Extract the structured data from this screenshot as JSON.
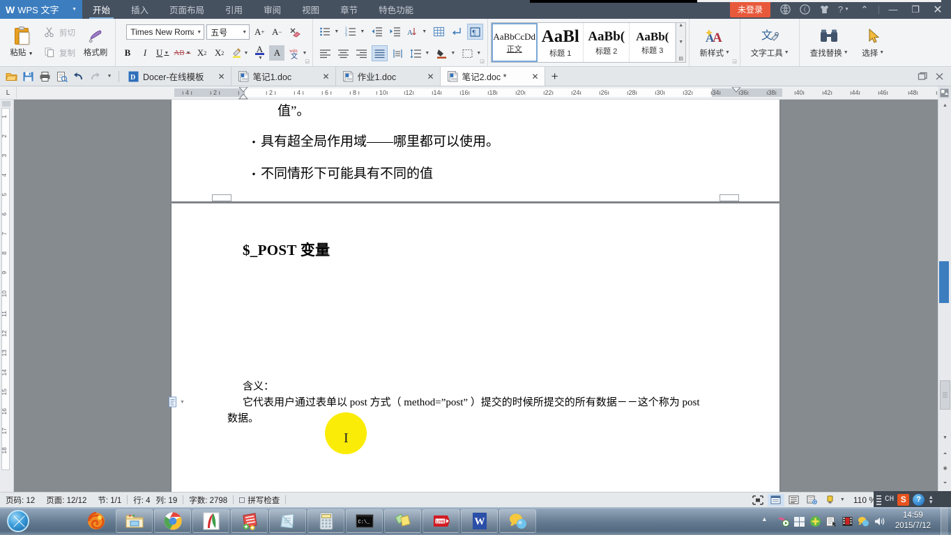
{
  "titlebar": {
    "app_name": "WPS 文字",
    "tabs": [
      {
        "label": "开始",
        "active": true
      },
      {
        "label": "插入",
        "active": false
      },
      {
        "label": "页面布局",
        "active": false
      },
      {
        "label": "引用",
        "active": false
      },
      {
        "label": "审阅",
        "active": false
      },
      {
        "label": "视图",
        "active": false
      },
      {
        "label": "章节",
        "active": false
      },
      {
        "label": "特色功能",
        "active": false
      }
    ],
    "login_label": "未登录",
    "icons": [
      "globe-icon",
      "moon-icon",
      "skin-icon",
      "help-icon"
    ],
    "window_controls": [
      "collapse-ribbon-icon",
      "minimize-icon",
      "restore-icon",
      "close-icon"
    ]
  },
  "ribbon": {
    "clipboard": {
      "paste_label": "粘贴",
      "cut_label": "剪切",
      "copy_label": "复制",
      "format_painter_label": "格式刷"
    },
    "font": {
      "font_family_value": "Times New Roma",
      "font_size_value": "五号",
      "buttons": [
        {
          "name": "grow-font-button",
          "glyph": "A⁺"
        },
        {
          "name": "shrink-font-button",
          "glyph": "A⁻"
        },
        {
          "name": "clear-format-button",
          "glyph": "✐"
        },
        {
          "name": "bold-button",
          "glyph": "B"
        },
        {
          "name": "italic-button",
          "glyph": "I"
        },
        {
          "name": "underline-button",
          "glyph": "U"
        },
        {
          "name": "strikethrough-button",
          "glyph": "AB"
        },
        {
          "name": "superscript-button",
          "glyph": "X²"
        },
        {
          "name": "subscript-button",
          "glyph": "X₂"
        },
        {
          "name": "highlight-button",
          "glyph": "✎"
        },
        {
          "name": "font-color-button",
          "glyph": "A"
        },
        {
          "name": "char-shading-button",
          "glyph": "A"
        },
        {
          "name": "pinyin-guide-button",
          "glyph": "文"
        }
      ]
    },
    "paragraph": {
      "buttons": [
        {
          "name": "bullet-list-button"
        },
        {
          "name": "numbered-list-button"
        },
        {
          "name": "decrease-indent-button"
        },
        {
          "name": "increase-indent-button"
        },
        {
          "name": "sort-button"
        },
        {
          "name": "borders-button"
        },
        {
          "name": "show-formatting-marks-button"
        },
        {
          "name": "align-left-button"
        },
        {
          "name": "align-center-button"
        },
        {
          "name": "align-right-button"
        },
        {
          "name": "justify-button"
        },
        {
          "name": "distribute-button"
        },
        {
          "name": "line-spacing-button"
        },
        {
          "name": "shading-button"
        },
        {
          "name": "border-style-button"
        }
      ]
    },
    "styles": {
      "items": [
        {
          "sample": "AaBbCcDd",
          "name": "正文",
          "selected": true
        },
        {
          "sample": "AaBl",
          "name": "标题 1",
          "selected": false
        },
        {
          "sample": "AaBb(",
          "name": "标题 2",
          "selected": false
        },
        {
          "sample": "AaBb(",
          "name": "标题 3",
          "selected": false
        }
      ]
    },
    "tools": [
      {
        "label": "新样式",
        "icon": "new-style-icon"
      },
      {
        "label": "文字工具",
        "icon": "text-tools-icon"
      },
      {
        "label": "查找替换",
        "icon": "find-replace-icon"
      },
      {
        "label": "选择",
        "icon": "select-icon"
      }
    ]
  },
  "quick_access": {
    "buttons": [
      "open-icon",
      "save-icon",
      "print-icon",
      "print-preview-icon",
      "undo-icon",
      "redo-icon",
      "customize-icon"
    ]
  },
  "doc_tabs": [
    {
      "label": "Docer-在线模板",
      "icon": "docer-icon",
      "active": false,
      "modified": false
    },
    {
      "label": "笔记1.doc",
      "icon": "wps-doc-icon",
      "active": false,
      "modified": false
    },
    {
      "label": "作业1.doc",
      "icon": "wps-doc-icon",
      "active": false,
      "modified": false
    },
    {
      "label": "笔记2.doc *",
      "icon": "wps-doc-icon",
      "active": true,
      "modified": true
    }
  ],
  "new_tab_label": "+",
  "ruler": {
    "corner_label": "L",
    "h_ticks": [
      "4",
      "2",
      "2",
      "4",
      "6",
      "8",
      "10",
      "12",
      "14",
      "16",
      "18",
      "20"
    ],
    "v_ticks": [
      "1",
      "2",
      "3",
      "4",
      "5",
      "6",
      "7",
      "8",
      "9",
      "10",
      "11",
      "12",
      "13",
      "14",
      "15",
      "16",
      "17",
      "18"
    ]
  },
  "document": {
    "page1_lines": [
      {
        "text": "值”。",
        "type": "plain"
      },
      {
        "text": "具有超全局作用域——哪里都可以使用。",
        "type": "bullet"
      },
      {
        "text": "不同情形下可能具有不同的值",
        "type": "bullet"
      }
    ],
    "page2_heading": "$_POST 变量",
    "page2_lines": [
      "含义：",
      "它代表用户通过表单以 post 方式（ method=”post” ）提交的时候所提交的所有数据－－这个称为 post",
      "数据。"
    ]
  },
  "statusbar": {
    "page_number": "页码: 12",
    "pages": "页面: 12/12",
    "section": "节: 1/1",
    "row": "行: 4",
    "column": "列: 19",
    "word_count": "字数: 2798",
    "spellcheck": "拼写检查",
    "zoom": "110 %",
    "view_buttons": [
      "full-screen-view-icon",
      "page-view-icon",
      "outline-view-icon",
      "web-view-icon",
      "reading-mode-icon"
    ]
  },
  "taskbar": {
    "start_label": "start-orb-icon",
    "items": [
      {
        "name": "firefox-icon",
        "pinned": true
      },
      {
        "name": "file-explorer-icon",
        "pinned": true
      },
      {
        "name": "chrome-icon",
        "pinned": true
      },
      {
        "name": "pdf-reader-icon",
        "pinned": true
      },
      {
        "name": "notepad-plus-icon",
        "pinned": true
      },
      {
        "name": "editplus-icon",
        "pinned": true
      },
      {
        "name": "calculator-icon",
        "pinned": true
      },
      {
        "name": "command-prompt-icon",
        "pinned": true
      },
      {
        "name": "sticky-notes-icon",
        "pinned": true
      },
      {
        "name": "live-recorder-icon",
        "pinned": true
      },
      {
        "name": "wps-writer-icon",
        "pinned": true
      },
      {
        "name": "qq-icon",
        "pinned": true
      }
    ],
    "tray": [
      "show-hidden-icons-icon",
      "media-player-icon",
      "windows-icon",
      "security-icon",
      "input-method-icon",
      "video-icon",
      "qq-tray-icon",
      "volume-icon"
    ],
    "clock_time": "14:59",
    "clock_date": "2015/7/12"
  },
  "ime": {
    "language": "CH",
    "sogou_label": "S",
    "help_label": "?"
  },
  "colors": {
    "titlebar_bg": "#465160",
    "logo_bg": "#3b7dbf",
    "login_bg": "#e8593c",
    "ribbon_bg": "#f3f4f6",
    "doc_bg": "#868b90",
    "highlight_yellow": "#fbec07",
    "accent_blue": "#3b7dbf"
  }
}
